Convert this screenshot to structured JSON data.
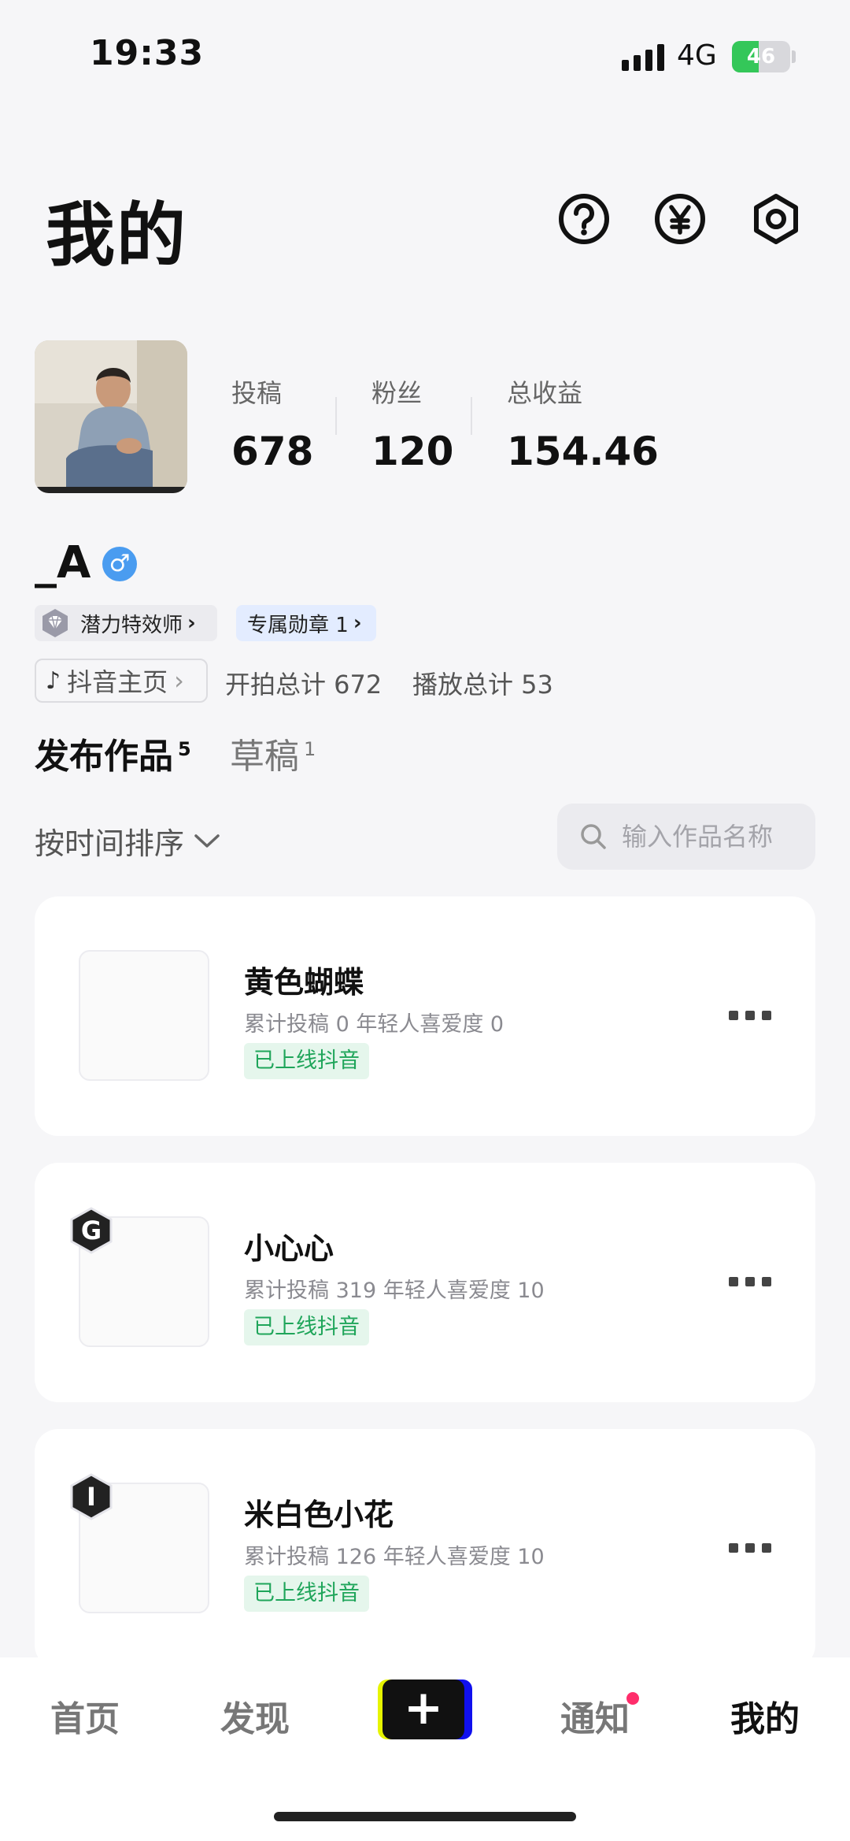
{
  "status_bar": {
    "time": "19:33",
    "network": "4G",
    "battery": "46",
    "battery_level": 0.46
  },
  "header": {
    "title": "我的",
    "icons": [
      "help-icon",
      "yen-icon",
      "settings-icon"
    ]
  },
  "profile": {
    "stats": [
      {
        "label": "投稿",
        "value": "678"
      },
      {
        "label": "粉丝",
        "value": "120"
      },
      {
        "label": "总收益",
        "value": "154.46"
      }
    ],
    "username": "_A",
    "gender": "♂",
    "tags": {
      "creator": "潜力特效师",
      "medal": "专属勋章 1",
      "arrow": "›"
    },
    "douyin_link": "抖音主页",
    "shoot_total": "开拍总计 672",
    "play_total": "播放总计 53"
  },
  "tabs": [
    {
      "label": "发布作品",
      "count": "5"
    },
    {
      "label": "草稿",
      "count": "1"
    }
  ],
  "filters": {
    "sort_label": "按时间排序",
    "search_placeholder": "输入作品名称"
  },
  "works": [
    {
      "title": "黄色蝴蝶",
      "stats": "累计投稿 0  年轻人喜爱度 0",
      "status": "已上线抖音",
      "badge": ""
    },
    {
      "title": "小心心",
      "stats": "累计投稿 319  年轻人喜爱度 10",
      "status": "已上线抖音",
      "badge": "G"
    },
    {
      "title": "米白色小花",
      "stats": "累计投稿 126  年轻人喜爱度 10",
      "status": "已上线抖音",
      "badge": "I"
    }
  ],
  "bottom_nav": {
    "home": "首页",
    "discover": "发现",
    "create": "+",
    "notifications": "通知",
    "me": "我的"
  },
  "colors": {
    "accent_green": "#1fa55a",
    "notify_dot": "#ff2d6b",
    "gender_blue": "#4a9cf0"
  }
}
